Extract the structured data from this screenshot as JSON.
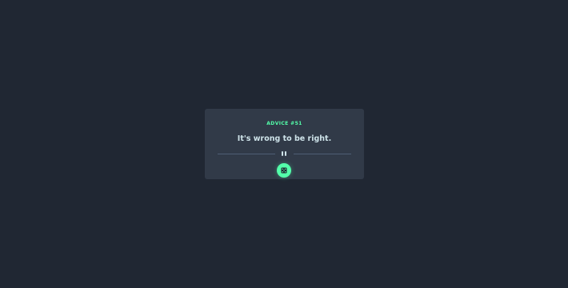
{
  "advice": {
    "id_label": "ADVICE #51",
    "text": "It's wrong to be right."
  },
  "icons": {
    "divider": "pause-icon",
    "button": "dice-icon"
  },
  "colors": {
    "background": "#202733",
    "card": "#313a48",
    "accent": "#53ffaa",
    "text": "#cee3e9",
    "divider": "#4f5d74"
  }
}
